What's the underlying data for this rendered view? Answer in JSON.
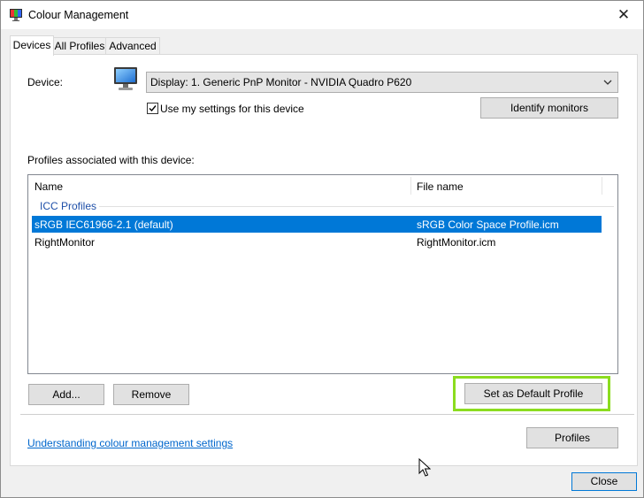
{
  "window": {
    "title": "Colour Management",
    "close_glyph": "✕"
  },
  "tabs": [
    {
      "label": "Devices",
      "active": true
    },
    {
      "label": "All Profiles",
      "active": false
    },
    {
      "label": "Advanced",
      "active": false
    }
  ],
  "device": {
    "label": "Device:",
    "selected": "Display: 1. Generic PnP Monitor - NVIDIA Quadro P620",
    "use_my_settings_label": "Use my settings for this device",
    "use_my_settings_checked": true,
    "identify_button": "Identify monitors",
    "icon": "monitor-icon"
  },
  "profiles": {
    "section_label": "Profiles associated with this device:",
    "columns": [
      "Name",
      "File name"
    ],
    "group": "ICC Profiles",
    "rows": [
      {
        "name": "sRGB IEC61966-2.1 (default)",
        "file": "sRGB Color Space Profile.icm",
        "selected": true
      },
      {
        "name": "RightMonitor",
        "file": "RightMonitor.icm",
        "selected": false
      }
    ]
  },
  "buttons": {
    "add": "Add...",
    "remove": "Remove",
    "set_default": "Set as Default Profile",
    "profiles": "Profiles",
    "close": "Close"
  },
  "footer": {
    "link": "Understanding colour management settings"
  },
  "colors": {
    "selection": "#0078d7",
    "highlight": "#8bdc1f",
    "link": "#0066cc"
  }
}
